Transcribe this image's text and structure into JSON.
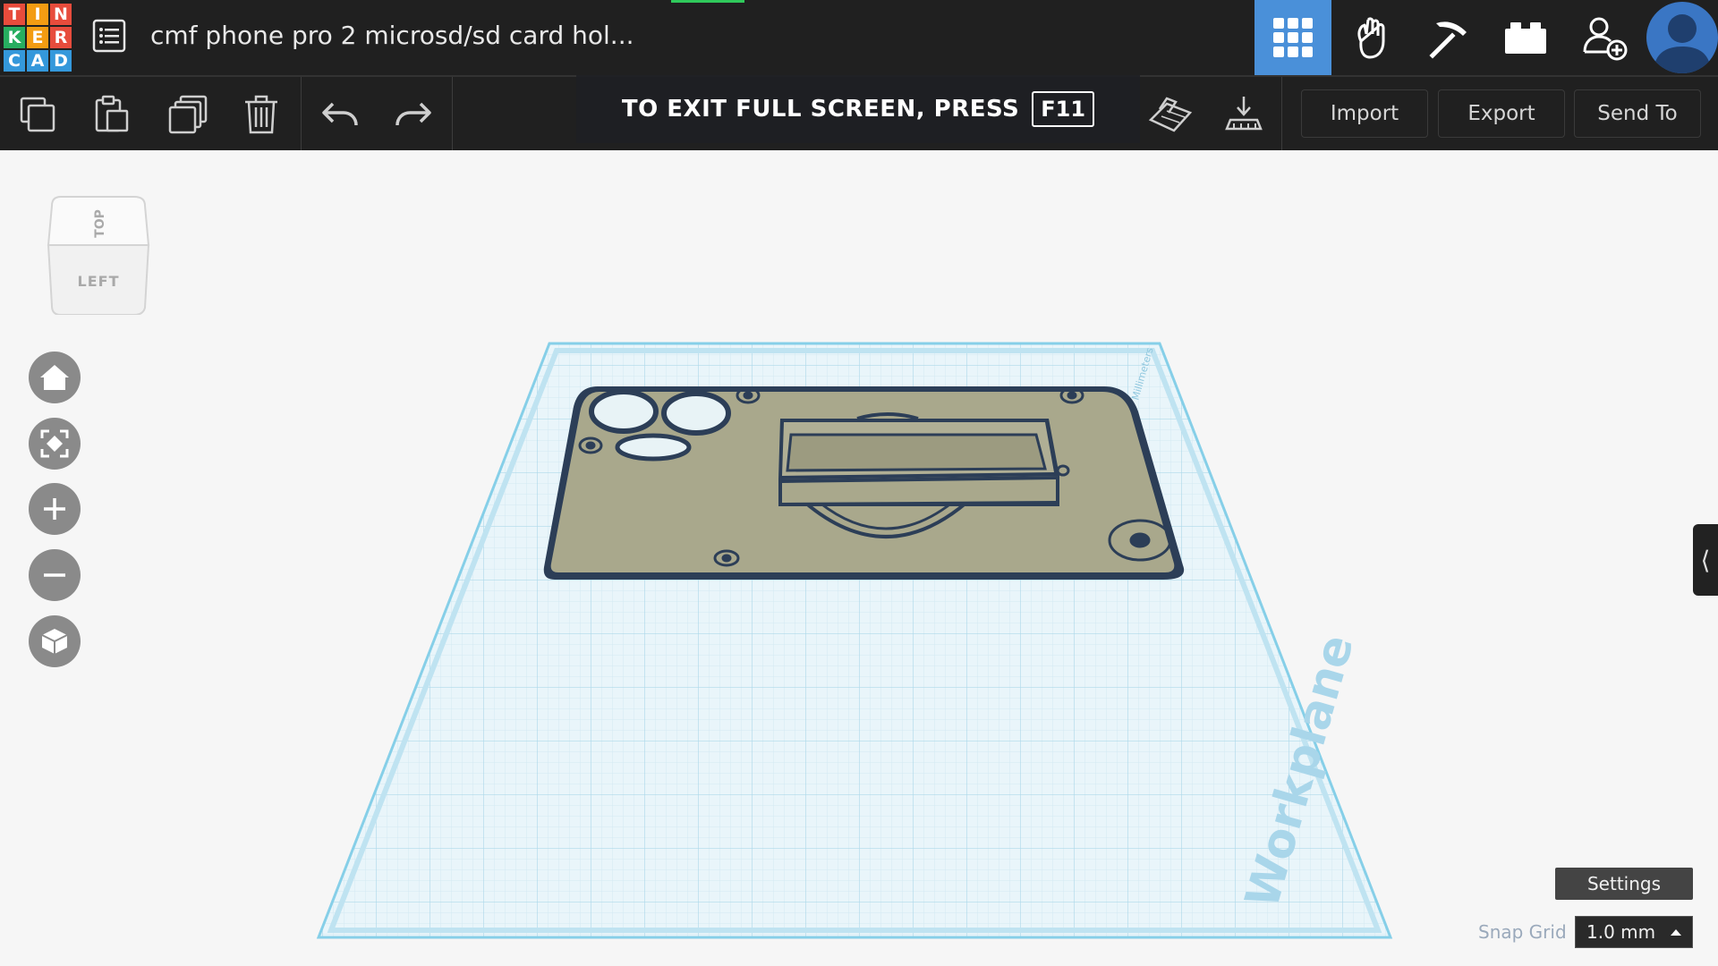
{
  "app": {
    "logo_letters": [
      "T",
      "I",
      "N",
      "K",
      "E",
      "R",
      "C",
      "A",
      "D"
    ],
    "logo_colors": [
      "#e74c3c",
      "#f39c12",
      "#e74c3c",
      "#27ae60",
      "#f39c12",
      "#e74c3c",
      "#3498db",
      "#3498db",
      "#3498db"
    ],
    "design_title": "cmf phone pro 2 microsd/sd card hol..."
  },
  "top_nav": {
    "items": [
      {
        "name": "3d-design",
        "icon": "grid-icon",
        "active": true
      },
      {
        "name": "circuits",
        "icon": "hand-icon",
        "active": false
      },
      {
        "name": "minecraft",
        "icon": "pickaxe-icon",
        "active": false
      },
      {
        "name": "lego",
        "icon": "brick-icon",
        "active": false
      },
      {
        "name": "add-user",
        "icon": "add-user-icon",
        "active": false
      }
    ],
    "accent_color": "#4a90d9"
  },
  "toolbar": {
    "copy": "copy-icon",
    "paste": "paste-icon",
    "duplicate": "duplicate-icon",
    "delete": "trash-icon",
    "undo": "undo-icon",
    "redo": "redo-icon",
    "workplane": "workplane-icon",
    "ruler": "ruler-icon",
    "import_label": "Import",
    "export_label": "Export",
    "send_to_label": "Send To"
  },
  "fullscreen_notice": {
    "text": "TO EXIT FULL SCREEN, PRESS",
    "key": "F11"
  },
  "viewcube": {
    "top_label": "TOP",
    "left_label": "LEFT"
  },
  "nav_controls": [
    "home-icon",
    "fit-icon",
    "zoom-in-icon",
    "zoom-out-icon",
    "ortho-icon"
  ],
  "workplane": {
    "label": "Workplane",
    "units_label": "Millimeters",
    "grid_color": "#b9e0ef",
    "edge_color": "#7fcbe6"
  },
  "model": {
    "fill_color": "#a9a88c",
    "outline_color": "#2c3e57"
  },
  "footer": {
    "settings_label": "Settings",
    "snap_grid_label": "Snap Grid",
    "snap_grid_value": "1.0 mm"
  }
}
